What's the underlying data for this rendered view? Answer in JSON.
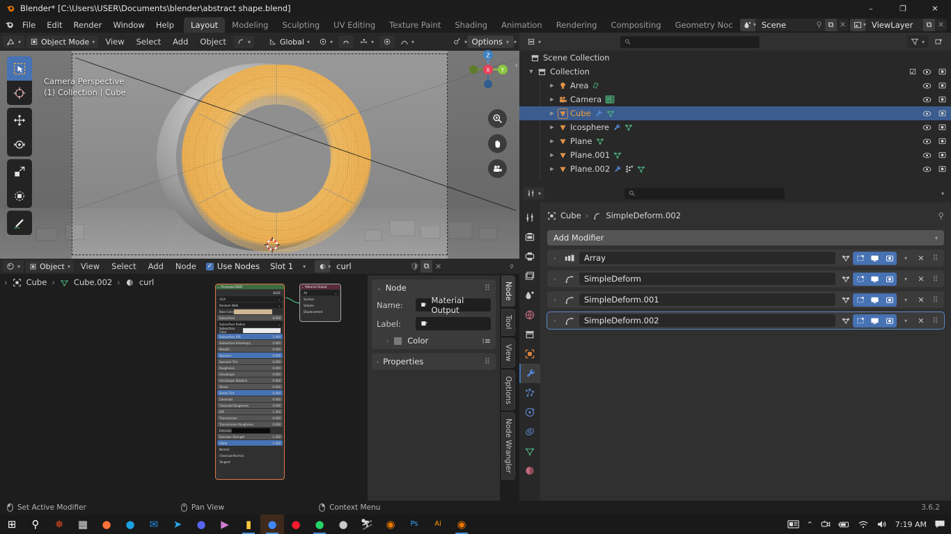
{
  "window": {
    "title": "Blender* [C:\\Users\\USER\\Documents\\blender\\abstract shape.blend]",
    "minimize": "–",
    "maximize": "❐",
    "close": "✕"
  },
  "topbar": {
    "menus": [
      "File",
      "Edit",
      "Render",
      "Window",
      "Help"
    ],
    "workspaces": [
      "Layout",
      "Modeling",
      "Sculpting",
      "UV Editing",
      "Texture Paint",
      "Shading",
      "Animation",
      "Rendering",
      "Compositing",
      "Geometry Noc"
    ],
    "active_workspace": "Layout",
    "scene_name": "Scene",
    "viewlayer_name": "ViewLayer"
  },
  "viewport": {
    "mode": "Object Mode",
    "menus": [
      "View",
      "Select",
      "Add",
      "Object"
    ],
    "transform_orientation": "Global",
    "options_label": "Options",
    "overlay_line1": "Camera Perspective",
    "overlay_line2": "(1) Collection | Cube",
    "gizmo_axes": [
      "X",
      "Y",
      "Z"
    ],
    "tools": [
      "select-box-tool",
      "cursor-tool",
      "move-tool",
      "rotate-tool",
      "scale-tool",
      "transform-tool",
      "annotate-tool"
    ],
    "nav_buttons": [
      "zoom-icon",
      "hand-icon",
      "camera-icon"
    ]
  },
  "outliner": {
    "search_placeholder": "",
    "root": "Scene Collection",
    "collection": "Collection",
    "items": [
      {
        "label": "Area",
        "type": "light",
        "icons": [
          "light-data-icon"
        ],
        "selected": false
      },
      {
        "label": "Camera",
        "type": "camera",
        "icons": [
          "camera-data-icon"
        ],
        "selected": false
      },
      {
        "label": "Cube",
        "type": "mesh",
        "icons": [
          "modifier-icon",
          "mesh-data-icon"
        ],
        "selected": true
      },
      {
        "label": "Icosphere",
        "type": "mesh",
        "icons": [
          "modifier-icon",
          "mesh-data-icon"
        ],
        "selected": false
      },
      {
        "label": "Plane",
        "type": "mesh",
        "icons": [
          "mesh-data-icon"
        ],
        "selected": false
      },
      {
        "label": "Plane.001",
        "type": "mesh",
        "icons": [
          "mesh-data-icon"
        ],
        "selected": false
      },
      {
        "label": "Plane.002",
        "type": "mesh",
        "icons": [
          "modifier-icon",
          "particles-icon",
          "mesh-data-icon"
        ],
        "selected": false
      }
    ]
  },
  "properties": {
    "search_placeholder": "",
    "breadcrumb_object": "Cube",
    "breadcrumb_modifier": "SimpleDeform.002",
    "add_modifier_label": "Add Modifier",
    "tabs": [
      "tool-tab",
      "render-tab",
      "output-tab",
      "viewlayer-tab",
      "scene-tab",
      "world-tab",
      "collection-tab",
      "object-tab",
      "modifier-tab",
      "particles-tab",
      "physics-tab",
      "constraints-tab",
      "data-tab",
      "material-tab"
    ],
    "active_tab": "modifier-tab",
    "modifiers": [
      {
        "name": "Array",
        "icon": "array-icon",
        "active": false
      },
      {
        "name": "SimpleDeform",
        "icon": "simpledeform-icon",
        "active": false
      },
      {
        "name": "SimpleDeform.001",
        "icon": "simpledeform-icon",
        "active": false
      },
      {
        "name": "SimpleDeform.002",
        "icon": "simpledeform-icon",
        "active": true
      }
    ],
    "modifier_toggles": [
      "edit-mode-display",
      "cage-display",
      "realtime-display",
      "render-display"
    ]
  },
  "shader_editor": {
    "shading_type": "Object",
    "menus": [
      "View",
      "Select",
      "Add",
      "Node"
    ],
    "use_nodes_label": "Use Nodes",
    "use_nodes_checked": true,
    "slot": "Slot 1",
    "material_name": "curl",
    "breadcrumb": [
      "Cube",
      "Cube.002",
      "curl"
    ],
    "nodes": {
      "bsdf": {
        "title": "Principled BSDF",
        "output_socket": "BSDF",
        "distribution": "GGX",
        "subsurface_method": "Random Walk",
        "fields": [
          {
            "label": "Base Color",
            "value": "",
            "style": "swatch-tan"
          },
          {
            "label": "Subsurface",
            "value": "0.000",
            "style": "normal"
          },
          {
            "label": "Subsurface Radius",
            "value": "",
            "style": "dropdown"
          },
          {
            "label": "Subsurface Color",
            "value": "",
            "style": "swatch-white"
          },
          {
            "label": "Subsurface IOR",
            "value": "1.400",
            "style": "blue"
          },
          {
            "label": "Subsurface Anisotropy",
            "value": "0.000",
            "style": "normal"
          },
          {
            "label": "Metallic",
            "value": "0.000",
            "style": "normal"
          },
          {
            "label": "Specular",
            "value": "0.000",
            "style": "blue"
          },
          {
            "label": "Specular Tint",
            "value": "0.000",
            "style": "normal"
          },
          {
            "label": "Roughness",
            "value": "0.000",
            "style": "normal"
          },
          {
            "label": "Anisotropic",
            "value": "0.000",
            "style": "normal"
          },
          {
            "label": "Anisotropic Rotation",
            "value": "0.000",
            "style": "normal"
          },
          {
            "label": "Sheen",
            "value": "0.000",
            "style": "normal"
          },
          {
            "label": "Sheen Tint",
            "value": "0.500",
            "style": "blue"
          },
          {
            "label": "Clearcoat",
            "value": "0.000",
            "style": "normal"
          },
          {
            "label": "Clearcoat Roughness",
            "value": "0.000",
            "style": "normal"
          },
          {
            "label": "IOR",
            "value": "1.450",
            "style": "normal"
          },
          {
            "label": "Transmission",
            "value": "0.000",
            "style": "normal"
          },
          {
            "label": "Transmission Roughness",
            "value": "0.000",
            "style": "normal"
          },
          {
            "label": "Emission",
            "value": "",
            "style": "swatch-black"
          },
          {
            "label": "Emission Strength",
            "value": "1.000",
            "style": "normal"
          },
          {
            "label": "Alpha",
            "value": "1.000",
            "style": "blue"
          },
          {
            "label": "Normal",
            "value": "",
            "style": "plain"
          },
          {
            "label": "Clearcoat Normal",
            "value": "",
            "style": "plain"
          },
          {
            "label": "Tangent",
            "value": "",
            "style": "plain"
          }
        ]
      },
      "output": {
        "title": "Material Output",
        "target": "All",
        "inputs": [
          "Surface",
          "Volume",
          "Displacement"
        ]
      }
    },
    "npanel": {
      "tabs": [
        "Node",
        "Tool",
        "View",
        "Options",
        "Node Wrangler"
      ],
      "active_tab": "Node",
      "section_node": "Node",
      "section_properties": "Properties",
      "name_label": "Name:",
      "name_value": "Material Output",
      "label_label": "Label:",
      "label_value": "",
      "color_label": "Color"
    }
  },
  "statusbar": {
    "items": [
      {
        "icon": "mouse-left-icon",
        "label": "Set Active Modifier"
      },
      {
        "icon": "mouse-middle-icon",
        "label": "Pan View"
      },
      {
        "icon": "mouse-right-icon",
        "label": "Context Menu"
      }
    ],
    "version": "3.6.2"
  },
  "taskbar": {
    "apps": [
      {
        "name": "start-button",
        "glyph": "⊞",
        "color": "#ffffff"
      },
      {
        "name": "search-icon",
        "glyph": "⚲",
        "color": "#ffffff"
      },
      {
        "name": "figma-icon",
        "glyph": "✵",
        "color": "#f24e1e"
      },
      {
        "name": "store-icon",
        "glyph": "▦",
        "color": "#dfdfdf"
      },
      {
        "name": "firefox-icon",
        "glyph": "●",
        "color": "#ff7139"
      },
      {
        "name": "edge-icon",
        "glyph": "●",
        "color": "#1ba1e2"
      },
      {
        "name": "mail-icon",
        "glyph": "✉",
        "color": "#1f8ce0"
      },
      {
        "name": "telegram-icon",
        "glyph": "➤",
        "color": "#29a9eb"
      },
      {
        "name": "discord-icon",
        "glyph": "●",
        "color": "#5865f2"
      },
      {
        "name": "media-player-icon",
        "glyph": "▶",
        "color": "#d07bd0"
      },
      {
        "name": "file-explorer-icon",
        "glyph": "▮",
        "color": "#ffc83d"
      },
      {
        "name": "chrome-icon",
        "glyph": "●",
        "color": "#4285f4"
      },
      {
        "name": "opera-icon",
        "glyph": "●",
        "color": "#ff1b2d"
      },
      {
        "name": "whatsapp-icon",
        "glyph": "●",
        "color": "#25d366"
      },
      {
        "name": "quicktime-icon",
        "glyph": "●",
        "color": "#c8c8c8"
      },
      {
        "name": "runner-app-icon",
        "glyph": "⛷",
        "color": "#d8d8d8"
      },
      {
        "name": "blender-icon",
        "glyph": "◉",
        "color": "#ea7600"
      },
      {
        "name": "photoshop-icon",
        "glyph": "Ps",
        "color": "#31a8ff"
      },
      {
        "name": "illustrator-icon",
        "glyph": "Ai",
        "color": "#ff9a00"
      },
      {
        "name": "blender-active-icon",
        "glyph": "◉",
        "color": "#ea7600"
      }
    ],
    "tray": {
      "news_icon": "news-icon",
      "chevron": "⌃",
      "camera_icon": "camera-privacy-icon",
      "battery_icon": "battery-icon",
      "wifi_icon": "wifi-icon",
      "volume_icon": "volume-icon",
      "clock": "7:19 AM",
      "notifications_icon": "notifications-icon"
    }
  }
}
